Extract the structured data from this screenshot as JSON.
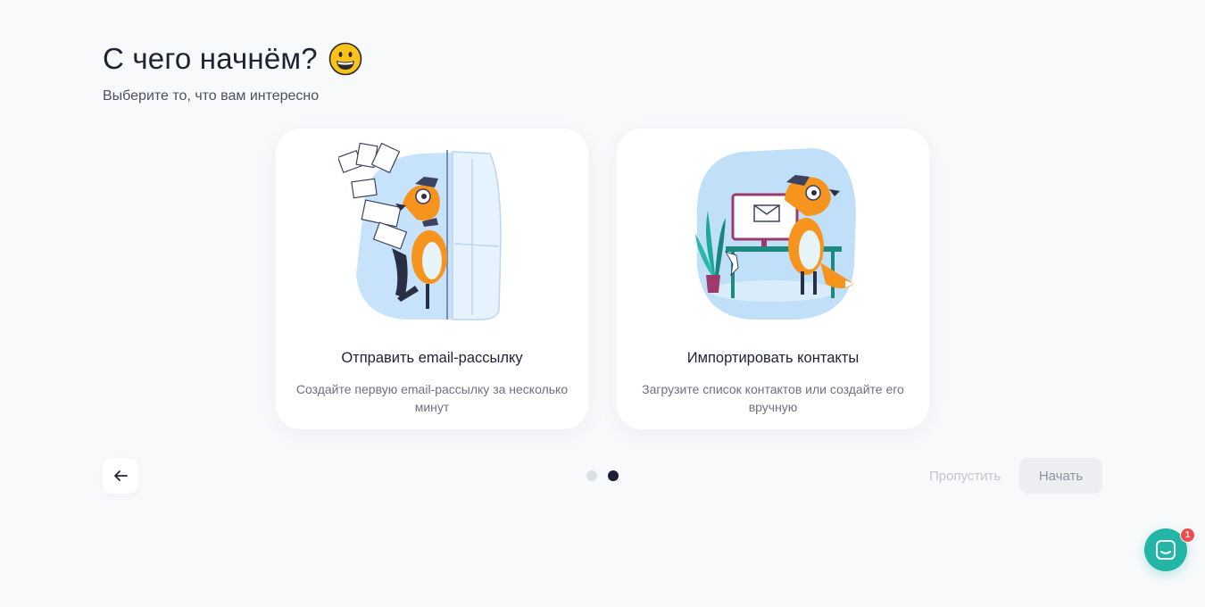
{
  "header": {
    "title": "С чего начнём?",
    "subtitle": "Выберите то, что вам интересно"
  },
  "cards": [
    {
      "title": "Отправить email-рассылку",
      "description": "Создайте первую email-рассылку за несколько минут",
      "icon": "fox-sending-letters-illustration"
    },
    {
      "title": "Импортировать контакты",
      "description": "Загрузите список контактов или создайте его вручную",
      "icon": "fox-at-computer-illustration"
    }
  ],
  "navigation": {
    "back_icon": "arrow-left-icon",
    "steps_total": 2,
    "current_step": 2,
    "skip_label": "Пропустить",
    "start_label": "Начать"
  },
  "chat": {
    "icon": "chat-bubble-icon",
    "badge_count": "1"
  },
  "colors": {
    "background": "#f8f9fb",
    "accent_chat": "#23b5a6",
    "badge": "#f04d4d",
    "dot_active": "#1a1f36",
    "dot_inactive": "#dcdfe6"
  }
}
